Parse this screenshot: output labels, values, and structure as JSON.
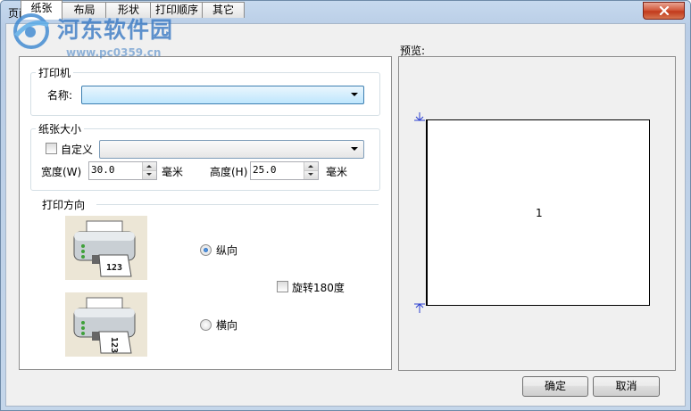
{
  "window": {
    "title": "页面属性"
  },
  "watermark": {
    "text": "河东软件园",
    "url": "www.pc0359.cn"
  },
  "tabs": [
    {
      "label": "纸张",
      "active": true
    },
    {
      "label": "布局",
      "active": false
    },
    {
      "label": "形状",
      "active": false
    },
    {
      "label": "打印顺序",
      "active": false
    },
    {
      "label": "其它",
      "active": false
    }
  ],
  "printer": {
    "group_label": "打印机",
    "name_label": "名称:",
    "name_value": ""
  },
  "paper": {
    "group_label": "纸张大小",
    "custom_label": "自定义",
    "custom_checked": false,
    "size_value": "",
    "width_label": "宽度(W)",
    "width_value": "30.0",
    "width_unit": "毫米",
    "height_label": "高度(H)",
    "height_value": "25.0",
    "height_unit": "毫米"
  },
  "orientation": {
    "group_label": "打印方向",
    "portrait_label": "纵向",
    "landscape_label": "横向",
    "selected": "portrait",
    "rotate_label": "旋转180度",
    "rotate_checked": false,
    "icon_text": "123"
  },
  "preview": {
    "label": "预览:",
    "page_number": "1"
  },
  "buttons": {
    "ok": "确定",
    "cancel": "取消"
  }
}
